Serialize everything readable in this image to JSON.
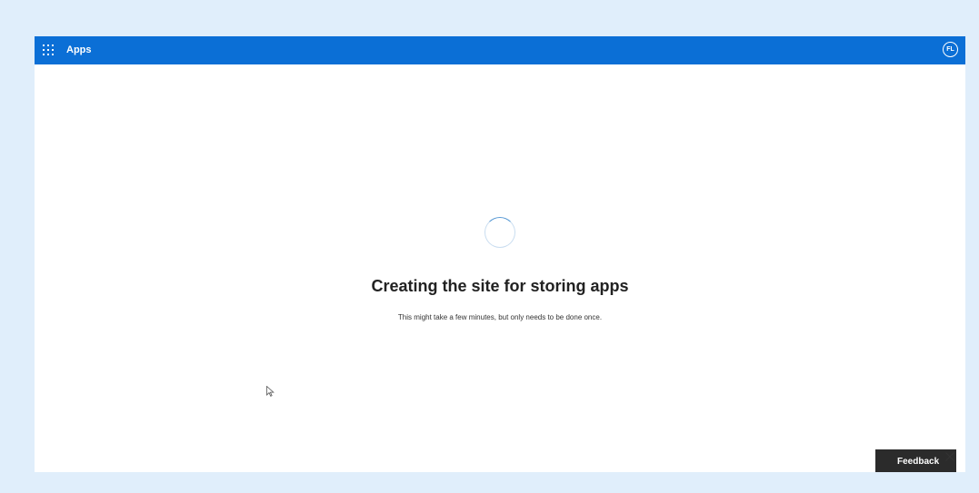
{
  "header": {
    "app_title": "Apps",
    "waffle_icon": "waffle-grid-icon",
    "avatar_initials": "FL"
  },
  "main": {
    "spinner_icon": "loading-spinner-icon",
    "heading": "Creating the site for storing apps",
    "subtext": "This might take a few minutes, but only needs to be done once."
  },
  "feedback": {
    "label": "Feedback",
    "close_icon": "close-icon"
  },
  "colors": {
    "page_background": "#e0eefb",
    "topbar": "#0b6fd6",
    "feedback_background": "#2b2b2b"
  }
}
